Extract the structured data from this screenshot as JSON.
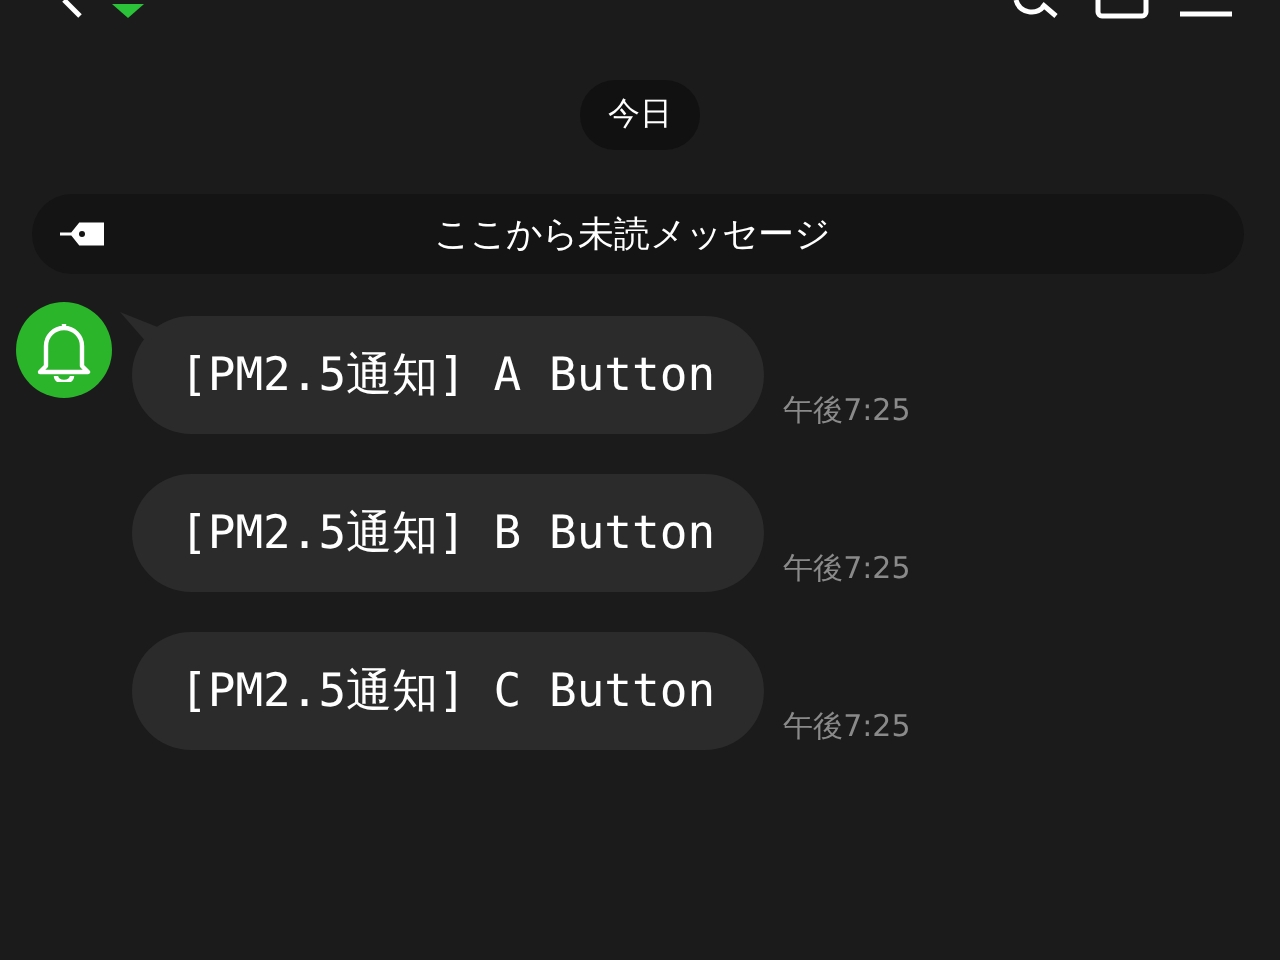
{
  "date_chip": "今日",
  "unread_divider": "ここから未読メッセージ",
  "messages": [
    {
      "text": "[PM2.5通知] A Button",
      "time": "午後7:25",
      "show_avatar": true
    },
    {
      "text": "[PM2.5通知] B Button",
      "time": "午後7:25",
      "show_avatar": false
    },
    {
      "text": "[PM2.5通知] C Button",
      "time": "午後7:25",
      "show_avatar": false
    }
  ]
}
